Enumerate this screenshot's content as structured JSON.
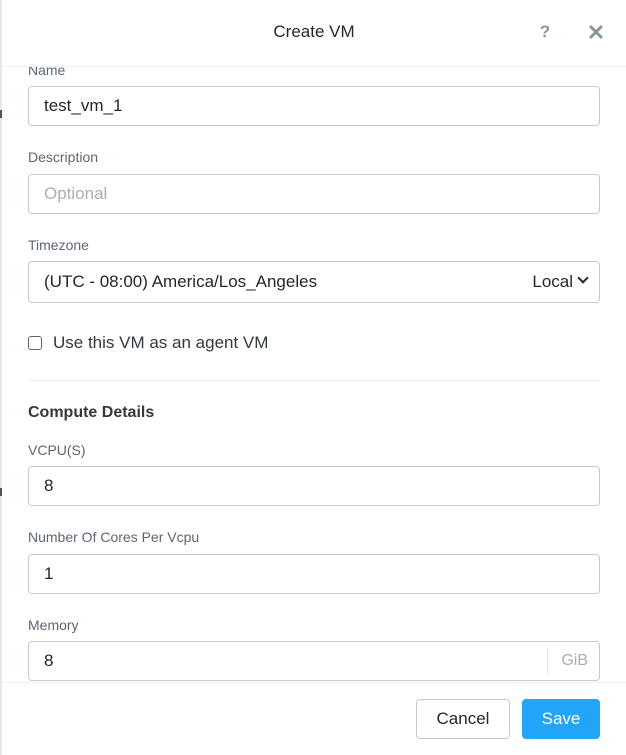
{
  "dialog": {
    "title": "Create VM",
    "help_icon": "question-icon",
    "help_glyph": "?",
    "close_icon": "close-icon",
    "close_glyph": "✕"
  },
  "form": {
    "name": {
      "label": "Name",
      "value": "test_vm_1"
    },
    "description": {
      "label": "Description",
      "placeholder": "Optional",
      "value": ""
    },
    "timezone": {
      "label": "Timezone",
      "value": "(UTC - 08:00) America/Los_Angeles",
      "mode": "Local",
      "chevron_icon": "chevron-down-icon"
    },
    "agent_vm": {
      "label": "Use this VM as an agent VM",
      "checked": false
    },
    "compute_details": {
      "title": "Compute Details",
      "vcpus": {
        "label": "VCPU(S)",
        "value": "8"
      },
      "cores_per_vcpu": {
        "label": "Number Of Cores Per Vcpu",
        "value": "1"
      },
      "memory": {
        "label": "Memory",
        "value": "8",
        "unit": "GiB"
      }
    }
  },
  "footer": {
    "cancel_label": "Cancel",
    "save_label": "Save"
  },
  "colors": {
    "primary": "#22a5f7",
    "border": "#c4cad3",
    "text": "#22272e",
    "muted": "#5c6672"
  }
}
